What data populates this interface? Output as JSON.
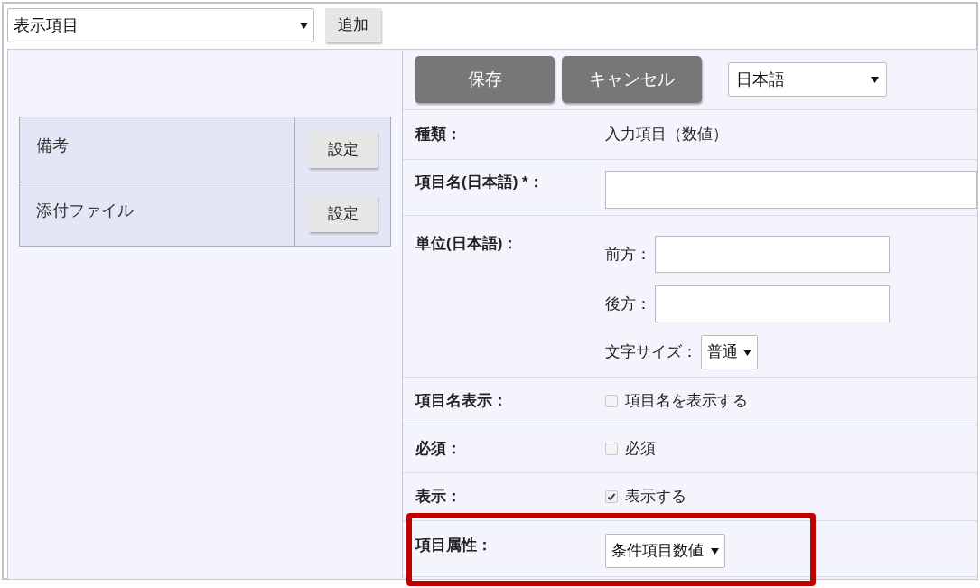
{
  "toolbar": {
    "select": "表示項目",
    "add_button": "追加"
  },
  "items": [
    {
      "name": "備考",
      "button": "設定"
    },
    {
      "name": "添付ファイル",
      "button": "設定"
    }
  ],
  "actions": {
    "save": "保存",
    "cancel": "キャンセル",
    "language": "日本語"
  },
  "fields": [
    {
      "kind": "text",
      "label": "種類：",
      "value": "入力項目（数値）"
    },
    {
      "kind": "input",
      "label": "項目名(日本語) *："
    },
    {
      "kind": "unit",
      "label": "単位(日本語)：",
      "before": "前方：",
      "after": "後方：",
      "size_label": "文字サイズ：",
      "size_value": "普通"
    },
    {
      "kind": "checkbox",
      "label": "項目名表示：",
      "text": "項目名を表示する",
      "checked": false
    },
    {
      "kind": "checkbox",
      "label": "必須：",
      "text": "必須",
      "checked": false
    },
    {
      "kind": "checkbox",
      "label": "表示：",
      "text": "表示する",
      "checked": true
    },
    {
      "kind": "select",
      "label": "項目属性：",
      "value": "条件項目数値"
    }
  ]
}
